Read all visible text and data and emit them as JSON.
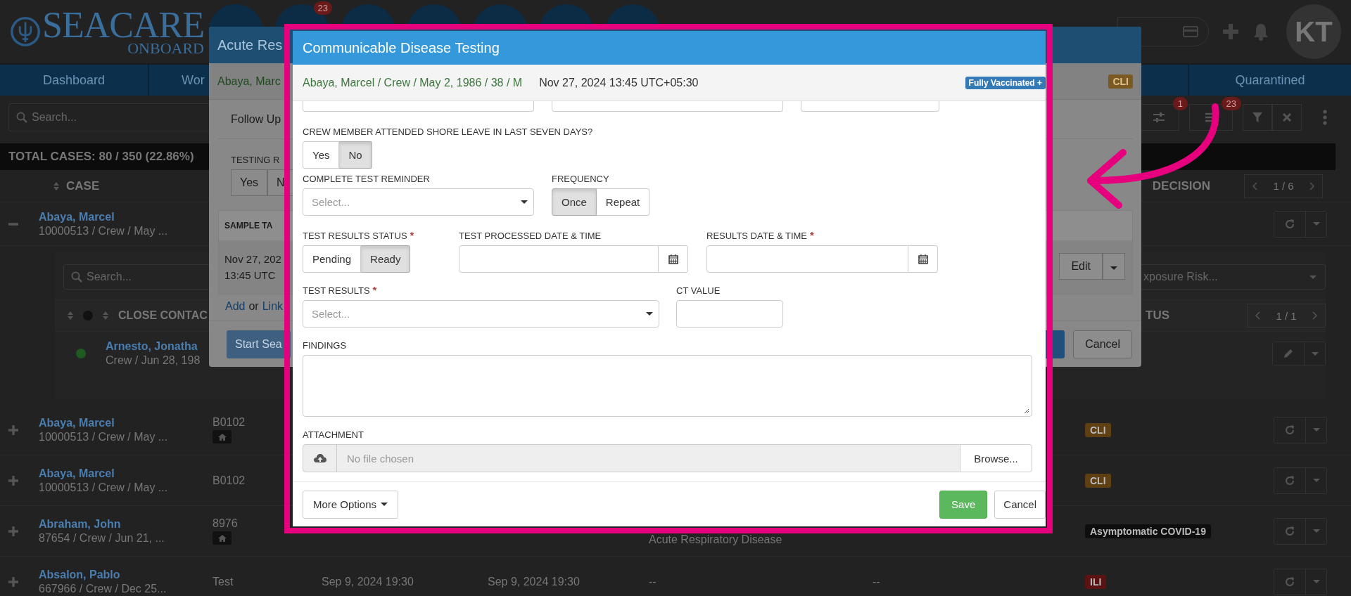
{
  "header": {
    "logo_text": "SEACARE",
    "logo_subtext": "ONBOARD",
    "shortcut_badge": "23",
    "avatar": "KT"
  },
  "nav_tabs": [
    {
      "label": "Dashboard"
    },
    {
      "label": "Wor"
    },
    {
      "label": "Quarantined"
    }
  ],
  "toolbar": {
    "search_placeholder": "Search...",
    "filter_badge": "1",
    "list_badge": "23"
  },
  "totals": "TOTAL CASES: 80 / 350 (22.86%)",
  "table": {
    "case_column": "CASE",
    "decision_column": "DECISION",
    "pager": "1 / 6",
    "rows": [
      {
        "expanded": true,
        "name": "Abaya, Marcel",
        "details": "10000513 / Crew / May ...",
        "contacts": {
          "search_placeholder": "Search...",
          "filter_placeholder": "xposure Risk...",
          "column": "CLOSE CONTAC",
          "status_column": "TUS",
          "pager": "1 / 1",
          "rows": [
            {
              "name": "Arnesto, Jonatha",
              "details": "Crew / Jun 28, 198",
              "color": "#1f5a20"
            }
          ]
        }
      },
      {
        "expanded": false,
        "name": "Abaya, Marcel",
        "details": "10000513 / Crew / May ...",
        "code": "B0102",
        "home": true,
        "tag": {
          "text": "CLI",
          "color": "#5e4012"
        }
      },
      {
        "expanded": false,
        "name": "Abaya, Marcel",
        "details": "10000513 / Crew / May ...",
        "code": "B0102",
        "home": false,
        "tag": {
          "text": "CLI",
          "color": "#5e4012"
        }
      },
      {
        "expanded": false,
        "name": "Abraham, John",
        "details": "87654 / Crew / Jun 21, ...",
        "code": "8976",
        "home": true,
        "disease_note": "Acute Respiratory Disease",
        "tag": {
          "text": "Asymptomatic COVID-19",
          "color": "#0e0e0e"
        }
      },
      {
        "expanded": false,
        "name": "Absalon, Pablo",
        "details": "667966 / Crew / Dec 25...",
        "code": "Test",
        "home": false,
        "date_1": "Sep 9, 2024 19:30",
        "date_2": "Sep 9, 2024 19:30",
        "disease": "--",
        "column_7": "--",
        "tag": {
          "text": "ILI",
          "color": "#5a1212"
        }
      }
    ]
  },
  "back_modal": {
    "title": "Acute Res",
    "patient": "Abaya, Marc",
    "tag": "CLI",
    "follow_up": "Follow Up",
    "testing_label": "TESTING R",
    "toggle": [
      {
        "label": "Yes",
        "selected": false
      },
      {
        "label": "N",
        "selected": false
      }
    ],
    "panel_header": "SAMPLE TA",
    "panel_date": "Nov 27, 202",
    "panel_time": "13:45 UTC",
    "add": "Add",
    "or": "or",
    "link": "Link",
    "edit": "Edit",
    "start": "Start Sea",
    "cancel": "Cancel"
  },
  "modal": {
    "title": "Communicable Disease Testing",
    "patient": "Abaya, Marcel / Crew / May 2, 1986 / 38 / M",
    "datetime": "Nov 27, 2024 13:45 UTC+05:30",
    "vaccination": "Fully Vaccinated +",
    "required_mark": "*",
    "shore_leave": {
      "label": "CREW MEMBER ATTENDED SHORE LEAVE IN LAST SEVEN DAYS?",
      "options": [
        {
          "label": "Yes",
          "selected": false
        },
        {
          "label": "No",
          "selected": true
        }
      ]
    },
    "reminder": {
      "label": "COMPLETE TEST REMINDER",
      "placeholder": "Select..."
    },
    "frequency": {
      "label": "FREQUENCY",
      "options": [
        {
          "label": "Once",
          "selected": true
        },
        {
          "label": "Repeat",
          "selected": false
        }
      ]
    },
    "status": {
      "label": "TEST RESULTS STATUS",
      "required": true,
      "options": [
        {
          "label": "Pending",
          "selected": false
        },
        {
          "label": "Ready",
          "selected": true
        }
      ]
    },
    "processed": {
      "label": "TEST PROCESSED DATE & TIME",
      "required": false
    },
    "results_date": {
      "label": "RESULTS DATE & TIME",
      "required": true
    },
    "results": {
      "label": "TEST RESULTS",
      "required": true,
      "placeholder": "Select..."
    },
    "ct": {
      "label": "CT VALUE",
      "required": false
    },
    "findings": {
      "label": "FINDINGS"
    },
    "attachment": {
      "label": "ATTACHMENT",
      "placeholder": "No file chosen",
      "button": "Browse..."
    },
    "footer": {
      "more": "More Options",
      "save": "Save",
      "cancel": "Cancel"
    }
  }
}
